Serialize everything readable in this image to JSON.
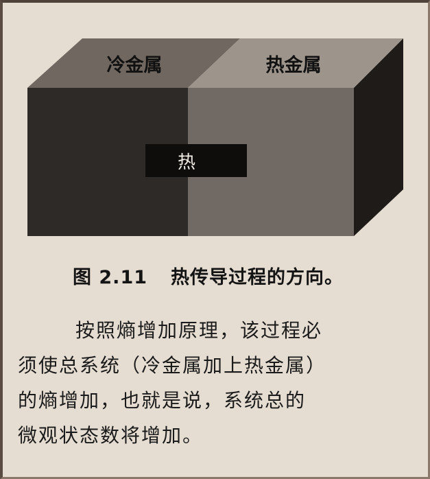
{
  "figure": {
    "cold_label": "冷金属",
    "hot_label": "热金属",
    "heat_label": "热",
    "colors": {
      "cold_front": "#2e2a27",
      "cold_top": "#6f6760",
      "hot_front": "#716a64",
      "hot_top": "#9d948c",
      "hot_side": "#1e1b19",
      "heat_arrow": "#0f0d0c"
    }
  },
  "caption": {
    "number": "图 2.11",
    "text": "热传导过程的方向。"
  },
  "paragraph": {
    "lines": [
      "按照熵增加原理，该过程必",
      "须使总系统（冷金属加上热金属）",
      "的熵增加，也就是说，系统总的",
      "微观状态数将增加。"
    ]
  }
}
